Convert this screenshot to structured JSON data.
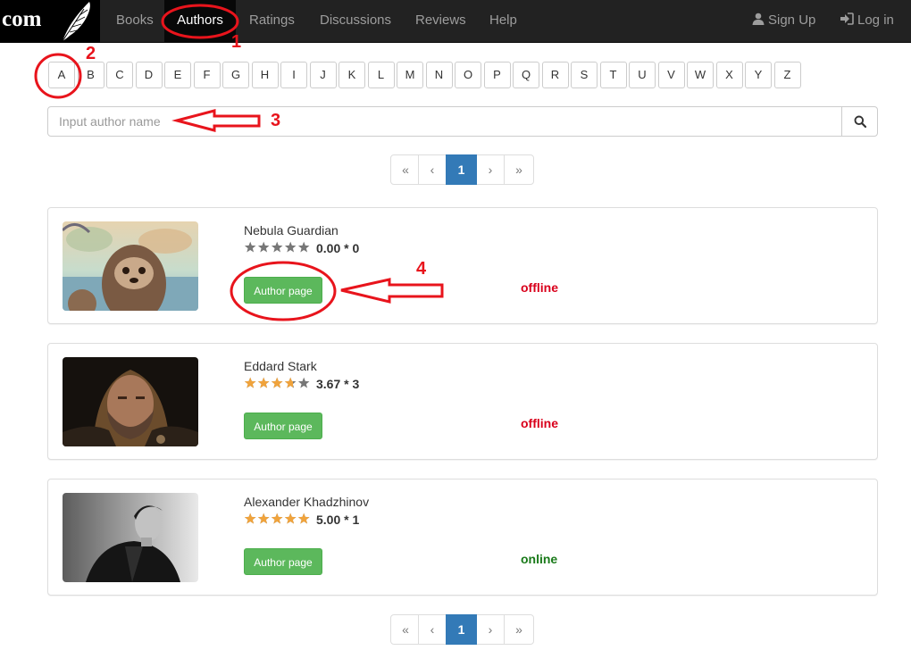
{
  "brand": {
    "text": "com"
  },
  "nav": {
    "items": [
      {
        "label": "Books"
      },
      {
        "label": "Authors"
      },
      {
        "label": "Ratings"
      },
      {
        "label": "Discussions"
      },
      {
        "label": "Reviews"
      },
      {
        "label": "Help"
      }
    ],
    "active": "Authors",
    "sign_up": "Sign Up",
    "log_in": "Log in"
  },
  "letters": [
    "A",
    "B",
    "C",
    "D",
    "E",
    "F",
    "G",
    "H",
    "I",
    "J",
    "K",
    "L",
    "M",
    "N",
    "O",
    "P",
    "Q",
    "R",
    "S",
    "T",
    "U",
    "V",
    "W",
    "X",
    "Y",
    "Z"
  ],
  "search": {
    "placeholder": "Input author name",
    "icon": "search-icon"
  },
  "pagination": {
    "first": "«",
    "prev": "‹",
    "current": "1",
    "next": "›",
    "last": "»"
  },
  "authors": [
    {
      "name": "Nebula Guardian",
      "rating": 0.0,
      "rating_text": "0.00 * 0",
      "button": "Author page",
      "status": "offline"
    },
    {
      "name": "Eddard Stark",
      "rating": 3.67,
      "rating_text": "3.67 * 3",
      "button": "Author page",
      "status": "offline"
    },
    {
      "name": "Alexander Khadzhinov",
      "rating": 5.0,
      "rating_text": "5.00 * 1",
      "button": "Author page",
      "status": "online"
    }
  ],
  "annotations": [
    "1",
    "2",
    "3",
    "4"
  ],
  "colors": {
    "navbar": "#222222",
    "accent": "#337ab7",
    "button_green": "#5cb85c",
    "star_filled": "#f0a33c",
    "star_empty": "#777777",
    "offline": "#d9001b",
    "online": "#1a7a1a",
    "annotation": "#e8141c"
  }
}
